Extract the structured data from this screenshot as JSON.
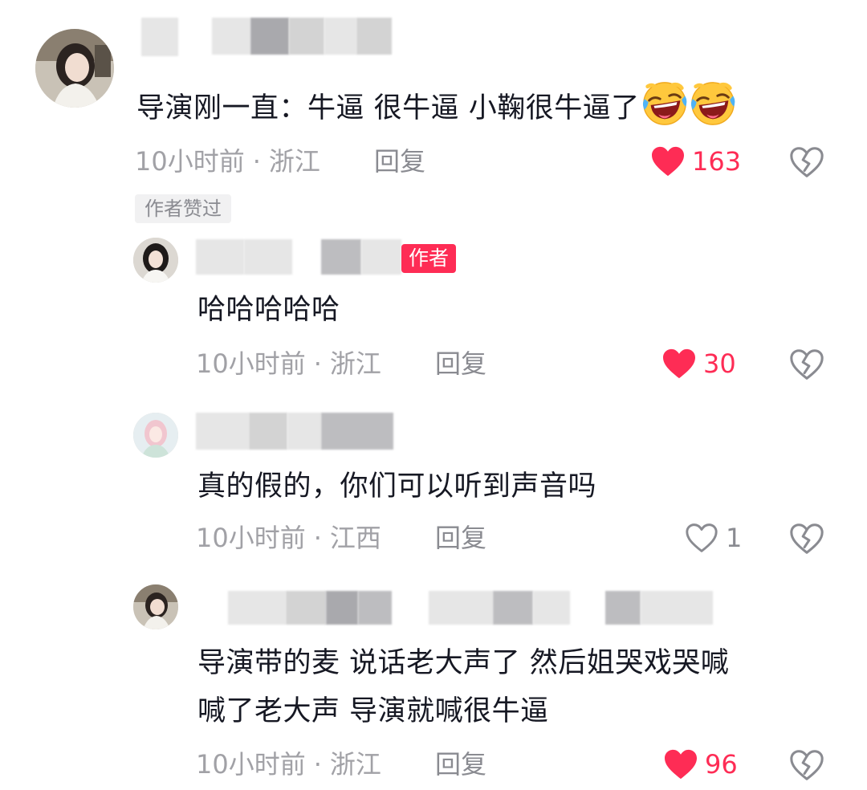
{
  "colors": {
    "accent": "#fe2c55",
    "meta_text": "#a1a1a6",
    "body_text": "#161823"
  },
  "comments": [
    {
      "text": "导演刚一直：牛逼 很牛逼 小鞠很牛逼了",
      "emojis": [
        "rofl-emoji",
        "rofl-emoji"
      ],
      "time": "10小时前",
      "location": "浙江",
      "reply_label": "回复",
      "likes": "163",
      "liked": true,
      "author_liked_label": "作者赞过"
    },
    {
      "is_author": true,
      "author_badge": "作者",
      "text": "哈哈哈哈哈",
      "time": "10小时前",
      "location": "浙江",
      "reply_label": "回复",
      "likes": "30",
      "liked": true
    },
    {
      "text": "真的假的，你们可以听到声音吗",
      "time": "10小时前",
      "location": "江西",
      "reply_label": "回复",
      "likes": "1",
      "liked": false
    },
    {
      "text_line1": "导演带的麦 说话老大声了 然后姐哭戏哭喊",
      "text_line2": "喊了老大声 导演就喊很牛逼",
      "time": "10小时前",
      "location": "浙江",
      "reply_label": "回复",
      "likes": "96",
      "liked": true
    }
  ]
}
